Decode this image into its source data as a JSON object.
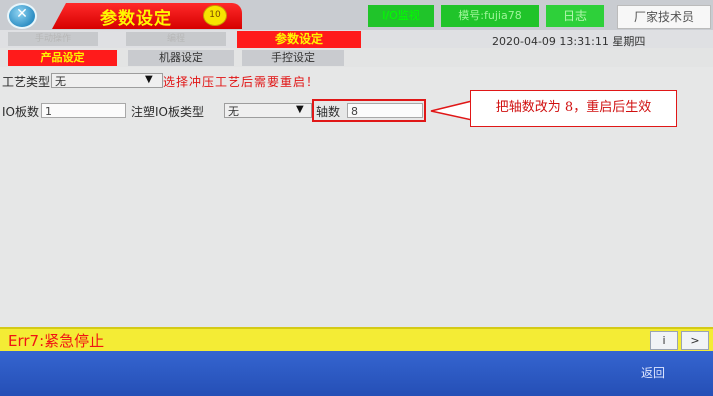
{
  "header": {
    "logo_glyph": "✕",
    "title": "参数设定",
    "page_badge": "10",
    "io_monitor": "I/O监视",
    "mold_label": "模号:fujia78",
    "log": "日志",
    "user": "厂家技术员"
  },
  "row2": {
    "ghost_tabs": [
      "手动操作",
      "编程"
    ],
    "param_tab": "参数设定",
    "datetime": "2020-04-09 13:31:11 星期四"
  },
  "subtabs": [
    "产品设定",
    "机器设定",
    "手控设定"
  ],
  "form": {
    "process_type_label": "工艺类型",
    "process_type_value": "无",
    "warning": "选择冲压工艺后需要重启！",
    "io_board_label": "IO板数",
    "io_board_value": "1",
    "inj_board_label": "注塑IO板类型",
    "inj_board_value": "无",
    "axis_label": "轴数",
    "axis_value": "8"
  },
  "callout": "把轴数改为 8，重启后生效",
  "status": {
    "error": "Err7:紧急停止",
    "info_btn": "i",
    "next_btn": ">"
  },
  "footer": {
    "return": "返回"
  },
  "colors": {
    "accent_red": "#ff1b1b",
    "title_yellow": "#fff600",
    "error_yellow": "#f4ec35",
    "footer_blue": "#2f5dc6",
    "green": "#2ed03a"
  }
}
